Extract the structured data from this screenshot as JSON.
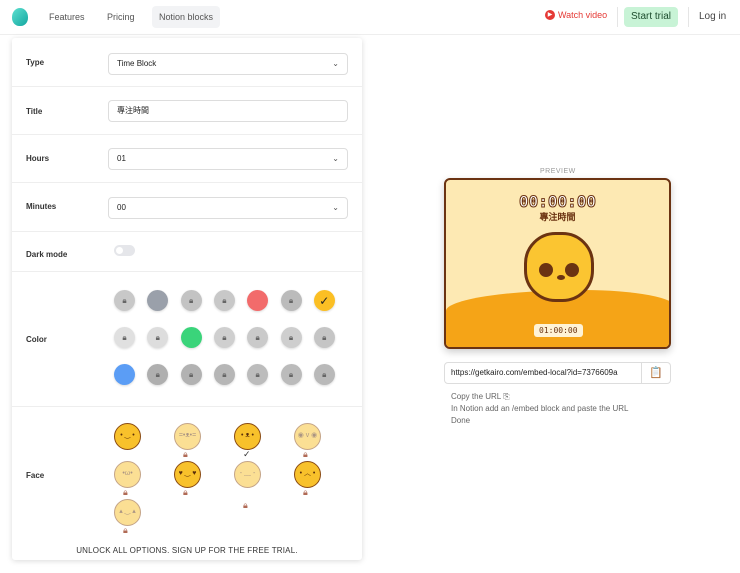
{
  "nav": {
    "links": [
      "Features",
      "Pricing",
      "Notion blocks"
    ],
    "watch_video": "Watch video",
    "start_trial": "Start trial",
    "login": "Log in"
  },
  "form": {
    "type": {
      "label": "Type",
      "value": "Time Block"
    },
    "title": {
      "label": "Title",
      "value": "專注時間"
    },
    "hours": {
      "label": "Hours",
      "value": "01"
    },
    "minutes": {
      "label": "Minutes",
      "value": "00"
    },
    "dark_mode": {
      "label": "Dark mode",
      "on": false
    },
    "color": {
      "label": "Color",
      "swatches": [
        [
          "#c3c8d1",
          "#9aa0aa",
          "#c3c3c3",
          "#c8c8c8",
          "#f26b6b",
          "#fbae86",
          "#fbbf24"
        ],
        [
          "#fbe08a",
          "#c4ec8e",
          "#3ad47a",
          "#8fe4c2",
          "#7fe0cf",
          "#7fe3ed",
          "#89d2f5"
        ],
        [
          "#5b9df5",
          "#a5abf7",
          "#bea7f7",
          "#d2a7f5",
          "#eda7f5",
          "#f6a7d3",
          "#f6a7b8"
        ]
      ],
      "locked": [
        [
          1,
          0,
          1,
          1,
          0,
          1,
          0
        ],
        [
          1,
          1,
          0,
          1,
          1,
          1,
          1
        ],
        [
          0,
          1,
          1,
          1,
          1,
          1,
          1
        ]
      ],
      "selected": "#fbbf24"
    },
    "face": {
      "label": "Face",
      "items": [
        {
          "name": "smile",
          "locked": false
        },
        {
          "name": "cat",
          "locked": true
        },
        {
          "name": "bear",
          "locked": false,
          "selected": true
        },
        {
          "name": "owl",
          "locked": true
        },
        {
          "name": "hamster",
          "locked": true
        },
        {
          "name": "heart-eyes",
          "locked": true
        },
        {
          "name": "drool",
          "locked": true
        },
        {
          "name": "chick",
          "locked": true
        },
        {
          "name": "pumpkin",
          "locked": true
        }
      ]
    },
    "footer": "UNLOCK ALL OPTIONS. SIGN UP FOR THE FREE TRIAL."
  },
  "preview": {
    "label": "PREVIEW",
    "timer": "00:00:00",
    "title": "專注時間",
    "duration": "01:00:00",
    "colors": {
      "bg": "#fde9b3",
      "wave": "#f5a417",
      "outline": "#6b3312"
    }
  },
  "embed": {
    "url": "https://getkairo.com/embed-local?id=7376609a",
    "steps": [
      "Copy the URL",
      "In Notion add an /embed block and paste the URL",
      "Done"
    ]
  }
}
